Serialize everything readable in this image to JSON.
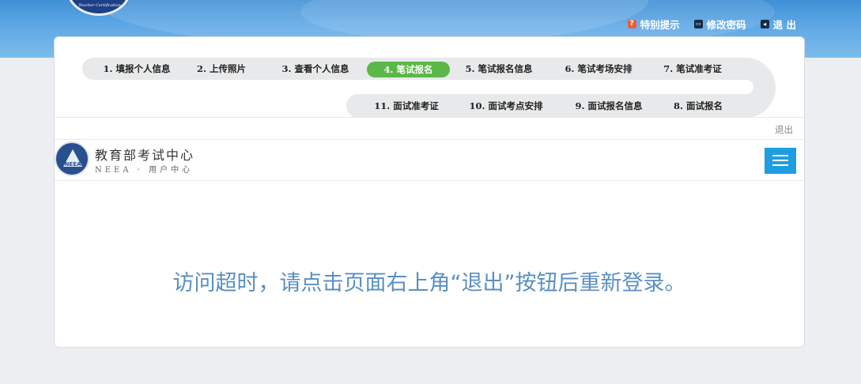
{
  "header": {
    "logo_text": "Teacher Certification",
    "links": {
      "hint": "特别提示",
      "password": "修改密码",
      "exit": "退 出"
    }
  },
  "steps": [
    {
      "label": "1. 填报个人信息"
    },
    {
      "label": "2. 上传照片"
    },
    {
      "label": "3. 查看个人信息"
    },
    {
      "label": "4. 笔试报名",
      "active": true
    },
    {
      "label": "5. 笔试报名信息"
    },
    {
      "label": "6. 笔试考场安排"
    },
    {
      "label": "7. 笔试准考证"
    },
    {
      "label": "11. 面试准考证"
    },
    {
      "label": "10. 面试考点安排"
    },
    {
      "label": "9. 面试报名信息"
    },
    {
      "label": "8. 面试报名"
    }
  ],
  "logout_small": "退出",
  "org": {
    "name": "教育部考试中心",
    "subtitle": "NEEA · 用户中心",
    "logo_abbr": "NEEA"
  },
  "message": "访问超时，请点击页面右上角“退出”按钮后重新登录。",
  "colors": {
    "active_step": "#5bb848",
    "menu_button": "#1e9ee0",
    "message_text": "#5a8fc2"
  }
}
